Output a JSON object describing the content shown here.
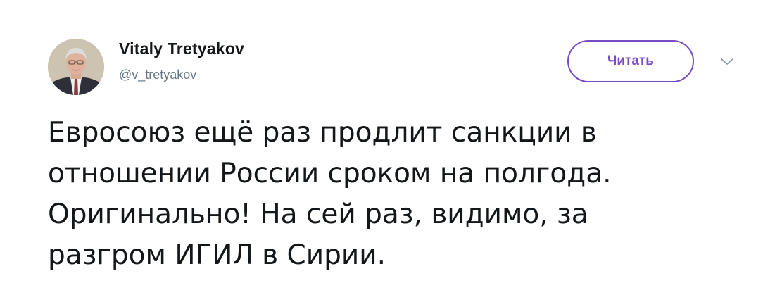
{
  "tweet": {
    "author": {
      "name": "Vitaly Tretyakov",
      "handle": "@v_tretyakov"
    },
    "follow_label": "Читать",
    "text_lines": [
      "Евросоюз ещё раз продлит санкции в",
      "отношении России сроком на полгода.",
      "Оригинально! На сей раз, видимо, за",
      "разгром ИГИЛ в Сирии."
    ]
  },
  "colors": {
    "accent": "#794bc4",
    "text": "#14171a",
    "secondary_text": "#657786"
  },
  "icons": {
    "caret": "chevron-down-icon"
  }
}
